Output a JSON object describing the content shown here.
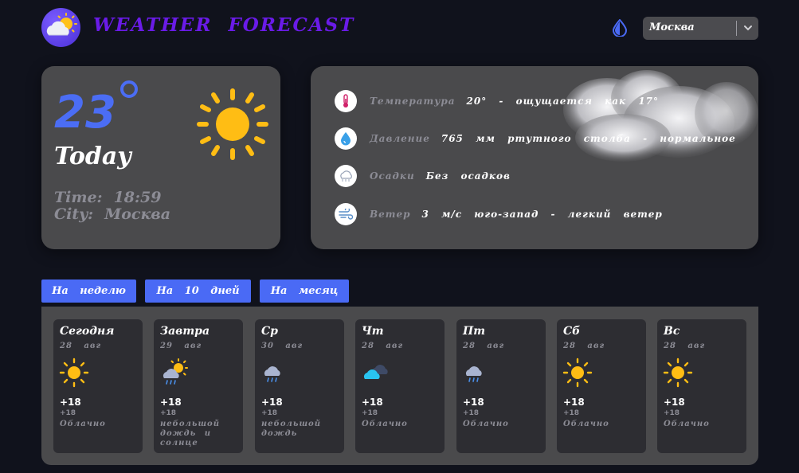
{
  "header": {
    "title": "WEATHER FORECAST",
    "city_select": {
      "value": "Москва"
    }
  },
  "today": {
    "temperature": "23",
    "label": "Today",
    "time_label": "Time:",
    "time_value": "18:59",
    "city_label": "City:",
    "city_value": "Москва"
  },
  "details": [
    {
      "name": "Температура",
      "value": "20° - ощущается как 17°",
      "icon": "thermometer-icon"
    },
    {
      "name": "Давление",
      "value": "765 мм ртутного столба - нормальное",
      "icon": "pressure-drop-icon"
    },
    {
      "name": "Осадки",
      "value": "Без осадков",
      "icon": "precipitation-icon"
    },
    {
      "name": "Ветер",
      "value": "3 м/с юго-запад - легкий ветер",
      "icon": "wind-icon"
    }
  ],
  "tabs": [
    {
      "label": "На неделю"
    },
    {
      "label": "На 10 дней"
    },
    {
      "label": "На месяц"
    }
  ],
  "forecast": [
    {
      "day": "Сегодня",
      "date": "28 авг",
      "icon": "sun-icon",
      "temp": "+18",
      "feels": "+18",
      "desc": "Облачно"
    },
    {
      "day": "Завтра",
      "date": "29 авг",
      "icon": "sun-cloud-rain-icon",
      "temp": "+18",
      "feels": "+18",
      "desc": "небольшой дождь и солнце"
    },
    {
      "day": "Ср",
      "date": "30 авг",
      "icon": "rain-cloud-icon",
      "temp": "+18",
      "feels": "+18",
      "desc": "небольшой дождь"
    },
    {
      "day": "Чт",
      "date": "28 авг",
      "icon": "clouds-icon",
      "temp": "+18",
      "feels": "+18",
      "desc": "Облачно"
    },
    {
      "day": "Пт",
      "date": "28 авг",
      "icon": "rain-cloud-icon",
      "temp": "+18",
      "feels": "+18",
      "desc": "Облачно"
    },
    {
      "day": "Сб",
      "date": "28 авг",
      "icon": "sun-icon",
      "temp": "+18",
      "feels": "+18",
      "desc": "Облачно"
    },
    {
      "day": "Вс",
      "date": "28 авг",
      "icon": "sun-icon",
      "temp": "+18",
      "feels": "+18",
      "desc": "Облачно"
    }
  ],
  "colors": {
    "background": "#10121c",
    "card": "#4a4a4c",
    "accent": "#4a6af5",
    "title": "#6a1be8",
    "sun": "#ffbd14"
  }
}
